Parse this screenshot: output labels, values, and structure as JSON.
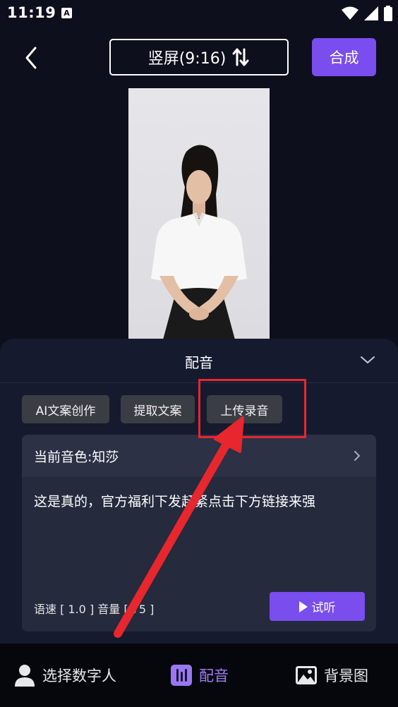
{
  "status_bar": {
    "time": "11:19",
    "notice": "A"
  },
  "header": {
    "ratio_label": "竖屏(9:16)",
    "compose_label": "合成"
  },
  "sheet": {
    "title": "配音",
    "chips": {
      "ai": "AI文案创作",
      "extract": "提取文案",
      "upload": "上传录音"
    },
    "voice": {
      "current": "当前音色:知莎",
      "text": "这是真的，官方福利下发赶紧点击下方链接来强",
      "params": "语速 [ 1.0 ] 音量 [ 75 ]",
      "listen_label": "试听"
    }
  },
  "nav": {
    "items": [
      {
        "label": "选择数字人"
      },
      {
        "label": "配音"
      },
      {
        "label": "背景图"
      }
    ]
  },
  "colors": {
    "accent": "#7a4dee",
    "background": "#0d0f1c",
    "sheet": "#151a2e",
    "annotation": "#e8262e"
  }
}
